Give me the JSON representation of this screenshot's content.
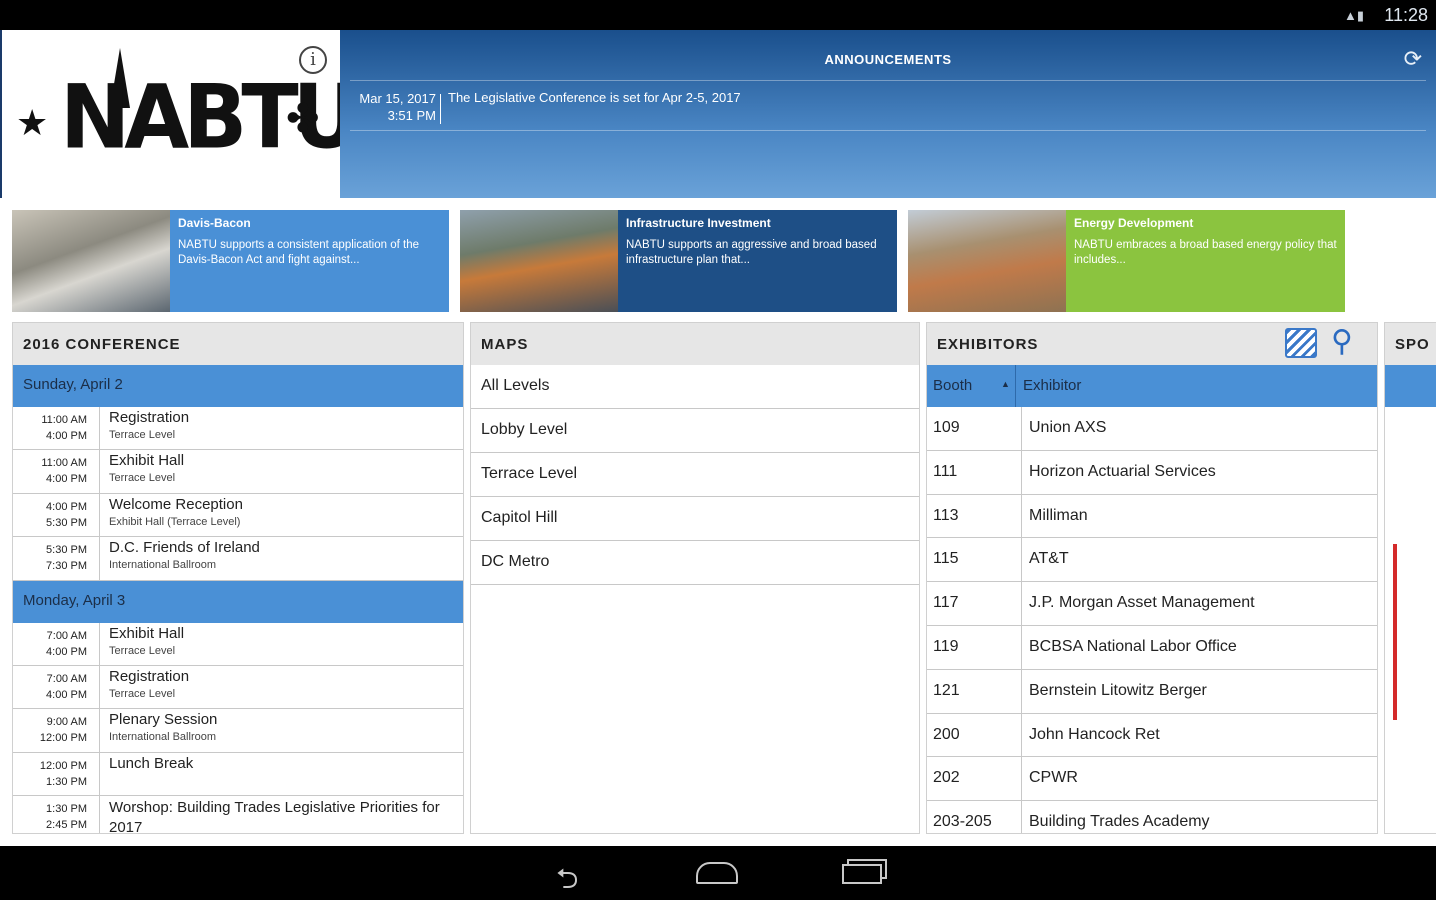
{
  "status_bar": {
    "time": "11:28",
    "signal_icon": "signal-icon",
    "battery_icon": "battery-icon"
  },
  "header": {
    "logo_text": "NABTU",
    "info_icon": "ⓘ",
    "announcements": {
      "title": "ANNOUNCEMENTS",
      "date_line1": "Mar 15, 2017",
      "date_line2": "3:51 PM",
      "text": "The Legislative Conference is set for Apr 2-5, 2017"
    }
  },
  "cards": [
    {
      "title": "Davis-Bacon",
      "text": "NABTU supports a consistent application of the Davis-Bacon Act and fight against...",
      "color": "#4a90d6"
    },
    {
      "title": "Infrastructure Investment",
      "text": "NABTU supports an aggressive and broad based infrastructure plan that...",
      "color": "#1e4f86"
    },
    {
      "title": "Energy Development",
      "text": "NABTU embraces a broad based energy policy that includes...",
      "color": "#8bc43f"
    }
  ],
  "conference": {
    "title": "2016 CONFERENCE",
    "days": [
      {
        "label": "Sunday, April 2",
        "sessions": [
          {
            "start": "11:00 AM",
            "end": "4:00 PM",
            "name": "Registration",
            "location": "Terrace Level"
          },
          {
            "start": "11:00 AM",
            "end": "4:00 PM",
            "name": "Exhibit Hall",
            "location": "Terrace Level"
          },
          {
            "start": "4:00 PM",
            "end": "5:30 PM",
            "name": "Welcome Reception",
            "location": "Exhibit Hall (Terrace Level)"
          },
          {
            "start": "5:30 PM",
            "end": "7:30 PM",
            "name": "D.C. Friends of Ireland",
            "location": "International Ballroom"
          }
        ]
      },
      {
        "label": "Monday, April 3",
        "sessions": [
          {
            "start": "7:00 AM",
            "end": "4:00 PM",
            "name": "Exhibit Hall",
            "location": "Terrace Level"
          },
          {
            "start": "7:00 AM",
            "end": "4:00 PM",
            "name": "Registration",
            "location": "Terrace Level"
          },
          {
            "start": "9:00 AM",
            "end": "12:00 PM",
            "name": "Plenary Session",
            "location": "International Ballroom"
          },
          {
            "start": "12:00 PM",
            "end": "1:30 PM",
            "name": "Lunch Break",
            "location": ""
          },
          {
            "start": "1:30 PM",
            "end": "2:45 PM",
            "name": "Worshop: Building Trades Legislative Priorities for 2017",
            "location": ""
          }
        ]
      }
    ]
  },
  "maps": {
    "title": "MAPS",
    "items": [
      "All Levels",
      "Lobby Level",
      "Terrace Level",
      "Capitol Hill",
      "DC Metro"
    ]
  },
  "exhibitors": {
    "title": "EXHIBITORS",
    "col_booth": "Booth",
    "col_exhibitor": "Exhibitor",
    "sort_indicator": "▲",
    "rows": [
      {
        "booth": "109",
        "name": "Union AXS"
      },
      {
        "booth": "111",
        "name": "Horizon Actuarial Services"
      },
      {
        "booth": "113",
        "name": "Milliman"
      },
      {
        "booth": "115",
        "name": "AT&T"
      },
      {
        "booth": "117",
        "name": "J.P. Morgan Asset Management"
      },
      {
        "booth": "119",
        "name": "BCBSA National Labor Office"
      },
      {
        "booth": "121",
        "name": "Bernstein Litowitz Berger"
      },
      {
        "booth": "200",
        "name": "John Hancock Ret"
      },
      {
        "booth": "202",
        "name": "CPWR"
      },
      {
        "booth": "203-205",
        "name": "Building Trades Academy"
      }
    ]
  },
  "sponsors": {
    "title_partial": "SPO"
  }
}
